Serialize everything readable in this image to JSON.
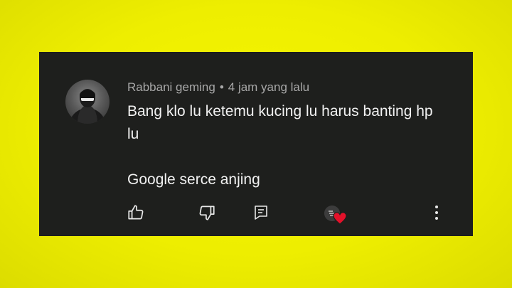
{
  "comment": {
    "author": "Rabbani geming",
    "separator": "•",
    "time": "4 jam yang lalu",
    "lines": [
      "Bang klo lu ketemu kucing lu harus banting hp lu",
      "Google serce anjing"
    ]
  },
  "actions": {
    "like_icon": "thumbs-up-icon",
    "dislike_icon": "thumbs-down-icon",
    "reply_icon": "reply-comment-icon",
    "creator_heart_icon": "creator-heart-icon",
    "more_icon": "more-vert-icon"
  },
  "colors": {
    "background": "#eeee00",
    "card": "#1e1f1d",
    "meta_text": "#a8a8a8",
    "body_text": "#f1f1f1",
    "heart": "#e3112a"
  }
}
